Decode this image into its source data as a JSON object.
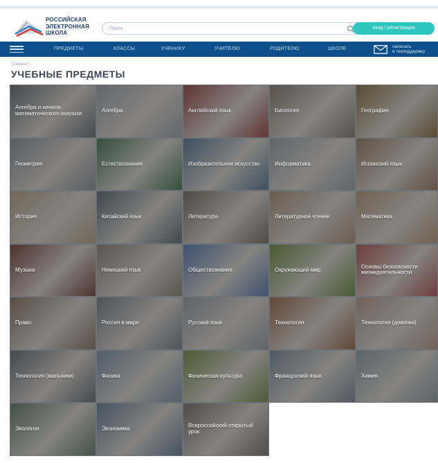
{
  "header": {
    "logo_lines": [
      "РОССИЙСКАЯ",
      "ЭЛЕКТРОННАЯ",
      "ШКОЛА"
    ],
    "search_placeholder": "Поиск",
    "login_label": "вход / регистрация"
  },
  "nav": {
    "items": [
      "ПРЕДМЕТЫ",
      "КЛАССЫ",
      "УЧЕНИКУ",
      "УЧИТЕЛЮ",
      "РОДИТЕЛЮ",
      "ШКОЛЕ"
    ],
    "support_lines": [
      "написать",
      "в техподдержку"
    ]
  },
  "breadcrumb": "Главная /",
  "page_title": "УЧЕБНЫЕ ПРЕДМЕТЫ",
  "colors": {
    "nav_bg": "#0d4f8a",
    "accent_button": "#2ec7c0",
    "logo_text": "#23406f"
  },
  "subjects": [
    {
      "label": "Алгебра и начала математического анализа",
      "icon": "formulas-chalkboard",
      "bg": "#5d6166"
    },
    {
      "label": "Алгебра",
      "icon": "formula-hand",
      "bg": "#8f9397"
    },
    {
      "label": "Английский язык",
      "icon": "phone-booth",
      "bg": "#8a3b37"
    },
    {
      "label": "Биология",
      "icon": "lizard",
      "bg": "#7a6e5e"
    },
    {
      "label": "География",
      "icon": "compass",
      "bg": "#7a6437"
    },
    {
      "label": "Геометрия",
      "icon": "drawing-tools",
      "bg": "#7d8186"
    },
    {
      "label": "Естествознание",
      "icon": "plant",
      "bg": "#3d6a47"
    },
    {
      "label": "Изобразительное искусство",
      "icon": "paints",
      "bg": "#4c6b86"
    },
    {
      "label": "Информатика",
      "icon": "keyboard",
      "bg": "#8b9096"
    },
    {
      "label": "Испанский язык",
      "icon": "cathedral",
      "bg": "#8a6f52"
    },
    {
      "label": "История",
      "icon": "columns",
      "bg": "#a69477"
    },
    {
      "label": "Китайский язык",
      "icon": "pagoda",
      "bg": "#4f5e66"
    },
    {
      "label": "Литература",
      "icon": "books",
      "bg": "#6e5f52"
    },
    {
      "label": "Литературное чтение",
      "icon": "book-drawing",
      "bg": "#9b8268"
    },
    {
      "label": "Математика",
      "icon": "hand-pencil",
      "bg": "#a58a6a"
    },
    {
      "label": "Музыка",
      "icon": "violin",
      "bg": "#6d3a30"
    },
    {
      "label": "Немецкий язык",
      "icon": "gate",
      "bg": "#7e776b"
    },
    {
      "label": "Обществознание",
      "icon": "figures",
      "bg": "#4d6da0"
    },
    {
      "label": "Окружающий мир",
      "icon": "leaves",
      "bg": "#5e7d32"
    },
    {
      "label": "Основы безопасности жизнедеятельности",
      "icon": "lifebuoy",
      "bg": "#a04a44"
    },
    {
      "label": "Право",
      "icon": "scales",
      "bg": "#7b6753"
    },
    {
      "label": "Россия в мире",
      "icon": "flag-clock",
      "bg": "#6b7079"
    },
    {
      "label": "Русский язык",
      "icon": "notebook",
      "bg": "#8a8d92"
    },
    {
      "label": "Технология",
      "icon": "origami",
      "bg": "#8d5d3d"
    },
    {
      "label": "Технология (девочки)",
      "icon": "sewing",
      "bg": "#a58c7a"
    },
    {
      "label": "Технология (мальчики)",
      "icon": "tools",
      "bg": "#5b5f63"
    },
    {
      "label": "Физика",
      "icon": "molecules",
      "bg": "#6f8497"
    },
    {
      "label": "Физическая культура",
      "icon": "grass",
      "bg": "#6a7d3a"
    },
    {
      "label": "Французский язык",
      "icon": "eiffel-tower",
      "bg": "#6e7c8a"
    },
    {
      "label": "Химия",
      "icon": "flasks",
      "bg": "#7f8f94"
    },
    {
      "label": "Экология",
      "icon": "sprout",
      "bg": "#55705a"
    },
    {
      "label": "Экономика",
      "icon": "chart",
      "bg": "#5a7187"
    },
    {
      "label": "Всероссийский открытый урок",
      "icon": "students",
      "bg": "#6b6660"
    }
  ]
}
